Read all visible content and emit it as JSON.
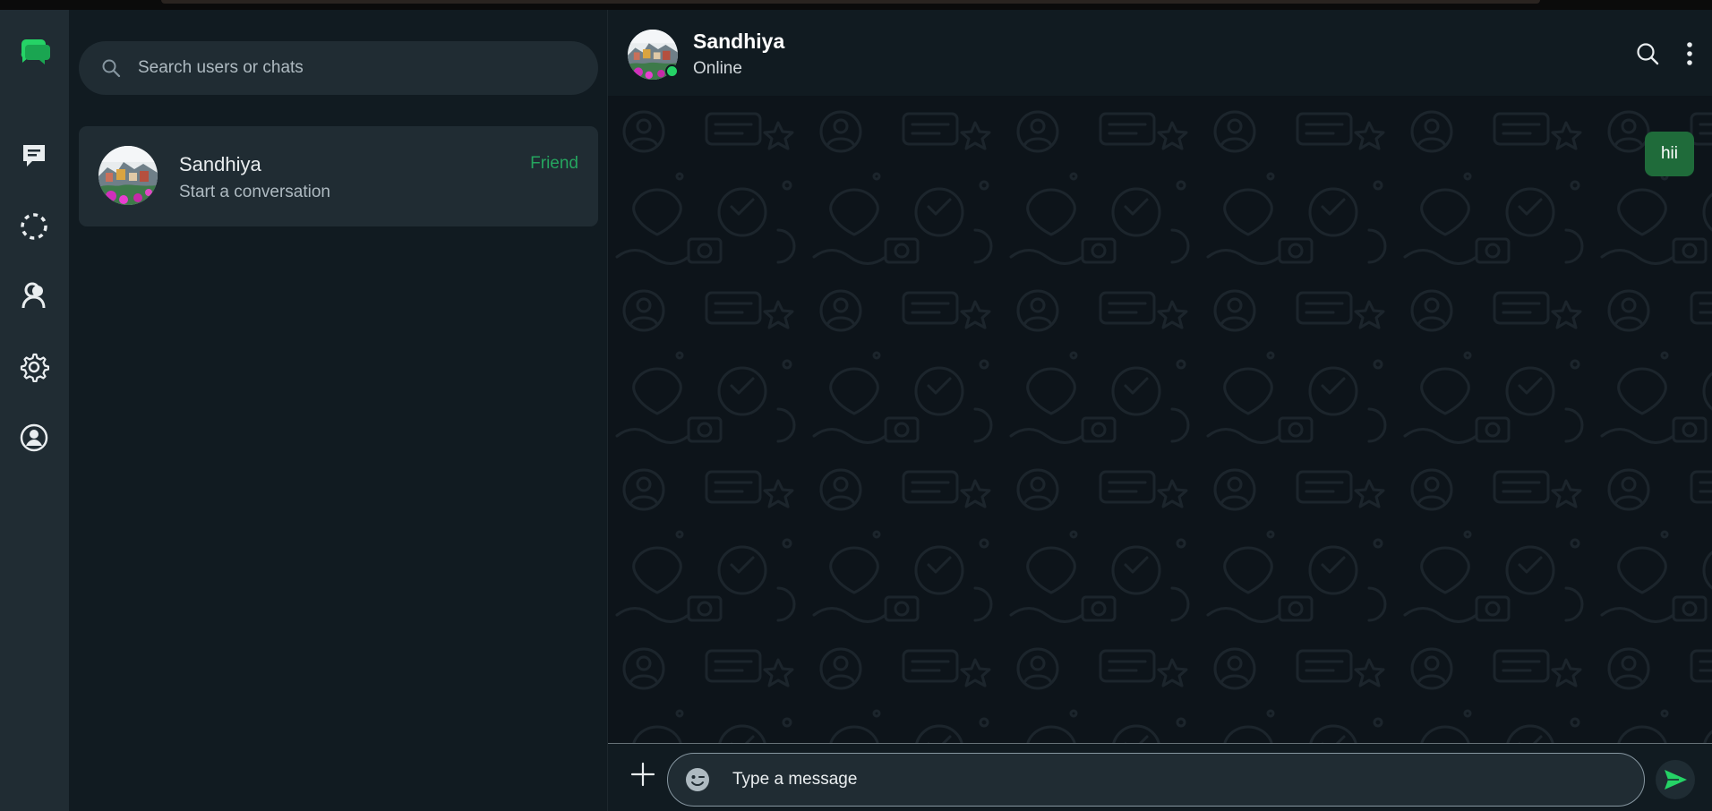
{
  "app": {
    "accent": "#25d366",
    "bubble_color": "#1f6b3a"
  },
  "rail": {
    "items": [
      {
        "icon": "app-logo-icon"
      },
      {
        "icon": "chats-icon"
      },
      {
        "icon": "status-icon"
      },
      {
        "icon": "contacts-icon"
      },
      {
        "icon": "settings-icon"
      },
      {
        "icon": "profile-icon"
      }
    ]
  },
  "search": {
    "placeholder": "Search users or chats",
    "icon": "search-icon"
  },
  "chat_list": [
    {
      "name": "Sandhiya",
      "subtitle": "Start a conversation",
      "tag": "Friend"
    }
  ],
  "chat_header": {
    "name": "Sandhiya",
    "status": "Online"
  },
  "messages": [
    {
      "text": "hii",
      "direction": "outgoing"
    }
  ],
  "composer": {
    "placeholder": "Type a message"
  }
}
